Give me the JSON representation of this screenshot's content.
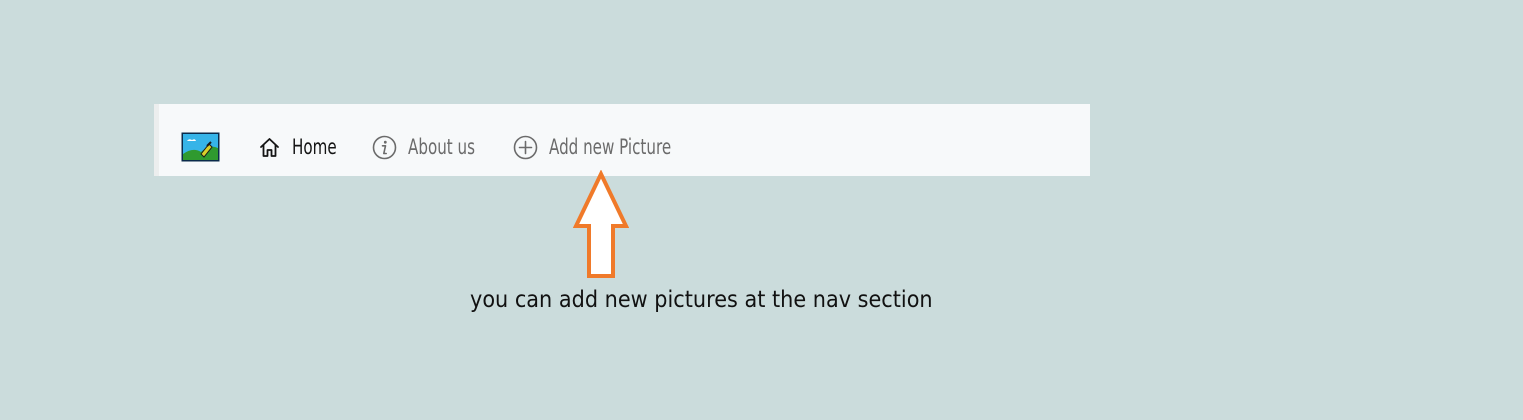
{
  "nav": {
    "logo_icon": "landscape-picture-icon",
    "items": [
      {
        "label": "Home",
        "icon": "home-icon",
        "active": true
      },
      {
        "label": "About us",
        "icon": "info-circle-icon",
        "active": false
      },
      {
        "label": "Add new Picture",
        "icon": "plus-circle-icon",
        "active": false
      }
    ]
  },
  "annotation": {
    "text": "you can add new pictures at the nav section",
    "arrow_color": "#f07a2a"
  },
  "colors": {
    "background": "#cbdcdc",
    "navbar": "#f7f9fa",
    "active_text": "#141414",
    "inactive_text": "#6b6b6b"
  }
}
